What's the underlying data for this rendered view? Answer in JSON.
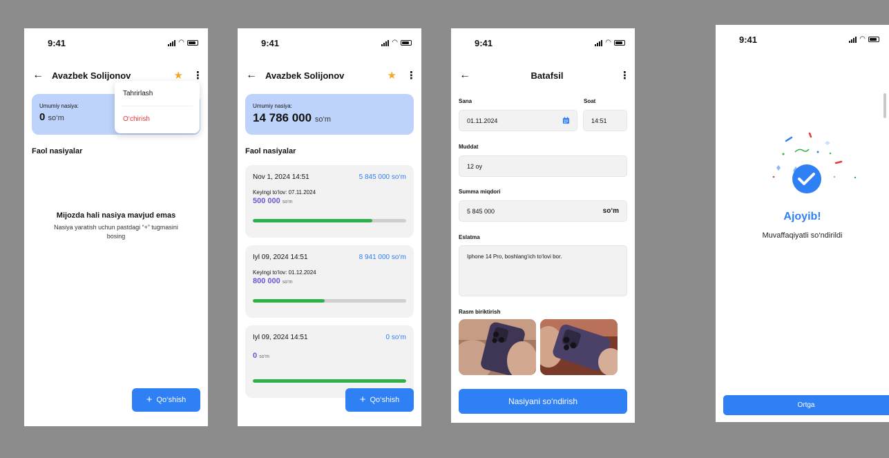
{
  "status": {
    "time": "9:41"
  },
  "screen1": {
    "title": "Avazbek Solijonov",
    "card_label": "Umumiy nasiya:",
    "card_amount": "0",
    "card_unit": "so‘m",
    "section": "Faol nasiyalar",
    "menu": {
      "edit": "Tahrirlash",
      "delete": "O‘chirish"
    },
    "empty_title": "Mijozda hali nasiya mavjud emas",
    "empty_subtitle": "Nasiya yaratish uchun pastdagi “+” tugmasini bosing",
    "add_button": "Qo‘shish"
  },
  "screen2": {
    "title": "Avazbek Solijonov",
    "card_label": "Umumiy nasiya:",
    "card_amount": "14 786 000",
    "card_unit": "so‘m",
    "section": "Faol nasiyalar",
    "add_button": "Qo‘shish",
    "loans": [
      {
        "date": "Nov 1, 2024 14:51",
        "total": "5 845 000 so‘m",
        "next": "Keyingi to‘lov: 07.11.2024",
        "payment": "500 000",
        "unit": "so‘m",
        "progress": 0.78
      },
      {
        "date": "Iyl 09, 2024 14:51",
        "total": "8 941 000 so‘m",
        "next": "Keyingi to‘lov: 01.12.2024",
        "payment": "800 000",
        "unit": "so‘m",
        "progress": 0.47
      },
      {
        "date": "Iyl 09, 2024 14:51",
        "total": "0 so‘m",
        "next": "",
        "payment": "0",
        "unit": "so‘m",
        "progress": 1.0
      }
    ]
  },
  "screen3": {
    "title": "Batafsil",
    "date_label": "Sana",
    "date_value": "01.11.2024",
    "time_label": "Soat",
    "time_value": "14:51",
    "term_label": "Muddat",
    "term_value": "12 oy",
    "sum_label": "Summa miqdori",
    "sum_value": "5 845 000",
    "sum_unit": "so‘m",
    "note_label": "Eslatma",
    "note_value": "Iphone 14 Pro, boshlang‘ich to‘lovi bor.",
    "photos_label": "Rasm biriktirish",
    "submit_button": "Nasiyani so‘ndirish"
  },
  "screen4": {
    "title": "Ajoyib!",
    "subtitle": "Muvaffaqiyatli so‘ndirildi",
    "back_button": "Ortga"
  },
  "colors": {
    "accent": "#2f7ff5",
    "card": "#bed3fb",
    "progress": "#2db24a",
    "payment": "#6b55d8",
    "star": "#f5a623",
    "danger": "#e53935"
  },
  "icons": [
    "back-arrow-icon",
    "star-icon",
    "more-vertical-icon",
    "plus-icon",
    "calendar-icon",
    "check-circle-icon",
    "signal-icon",
    "wifi-icon",
    "battery-icon"
  ]
}
